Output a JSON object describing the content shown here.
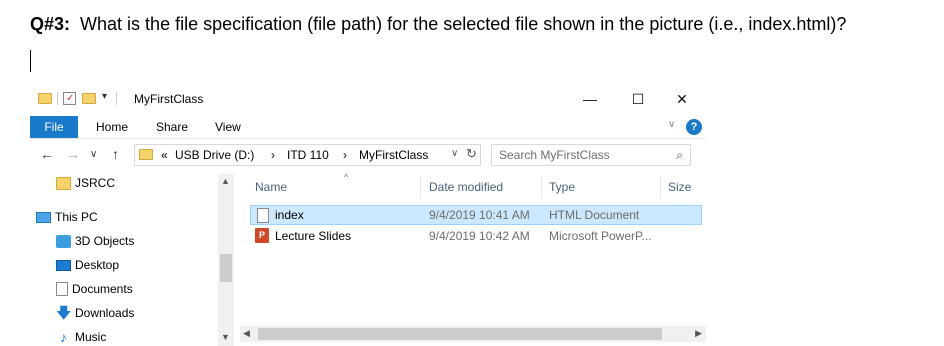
{
  "question": {
    "number": "Q#3:",
    "text": "What is the file specification (file path) for the selected file shown in the picture (i.e., index.html)?"
  },
  "window": {
    "title": "MyFirstClass",
    "controls": {
      "minimize": "—",
      "maximize": "☐",
      "close": "✕"
    }
  },
  "ribbon": {
    "tabs": [
      "File",
      "Home",
      "Share",
      "View"
    ],
    "help": "?",
    "collapse": "∨"
  },
  "nav": {
    "back": "←",
    "forward": "→",
    "recent": "∨",
    "up": "↑",
    "breadcrumb": [
      "«",
      "USB Drive (D:)",
      "›",
      "ITD 110",
      "›",
      "MyFirstClass"
    ],
    "search_placeholder": "Search MyFirstClass"
  },
  "navpane": {
    "items": [
      {
        "label": "JSRCC",
        "icon": "folder-icon"
      },
      {
        "label": "This PC",
        "icon": "computer-icon"
      },
      {
        "label": "3D Objects",
        "icon": "cube-icon"
      },
      {
        "label": "Desktop",
        "icon": "desktop-icon"
      },
      {
        "label": "Documents",
        "icon": "documents-icon"
      },
      {
        "label": "Downloads",
        "icon": "download-icon"
      },
      {
        "label": "Music",
        "icon": "music-icon"
      }
    ]
  },
  "filelist": {
    "columns": [
      "Name",
      "Date modified",
      "Type",
      "Size"
    ],
    "rows": [
      {
        "name": "index",
        "date": "9/4/2019 10:41 AM",
        "type": "HTML Document",
        "selected": true
      },
      {
        "name": "Lecture Slides",
        "date": "9/4/2019 10:42 AM",
        "type": "Microsoft PowerP...",
        "selected": false
      }
    ]
  },
  "colors": {
    "accent": "#1979ca",
    "selection": "#cce8ff",
    "folder": "#f6d26b"
  }
}
